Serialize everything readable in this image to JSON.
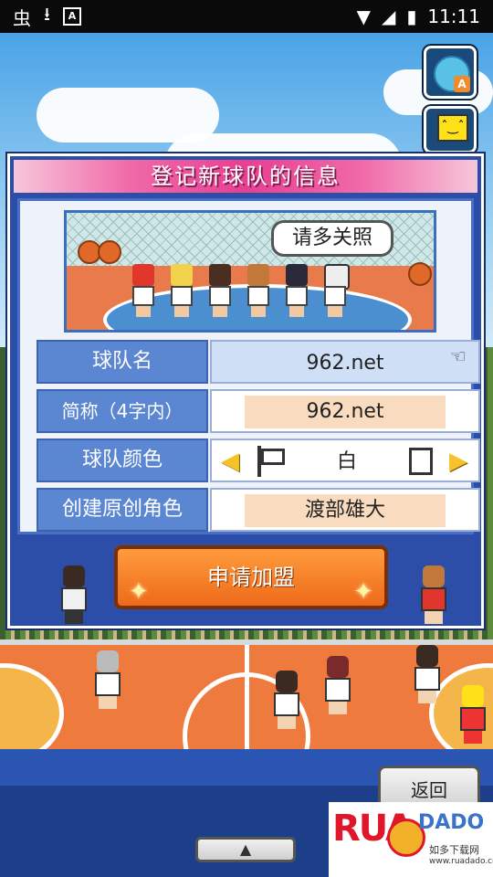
{
  "status_bar": {
    "left_icons": [
      "bug-icon",
      "download-icon",
      "a-icon"
    ],
    "time": "11:11",
    "right_icons": [
      "wifi-icon",
      "signal-icon",
      "battery-icon"
    ]
  },
  "dialog": {
    "title": "登记新球队的信息",
    "banner_speech": "请多关照",
    "fields": [
      {
        "label": "球队名",
        "value": "962.net"
      },
      {
        "label": "简称（4字内）",
        "value": "962.net"
      },
      {
        "label": "球队颜色",
        "value": "白"
      },
      {
        "label": "创建原创角色",
        "value": "渡部雄大"
      }
    ],
    "join_button": "申请加盟"
  },
  "back_button": "返回",
  "watermark": {
    "brand": "RUADADO",
    "sub": "如多下载网",
    "url": "www.ruadado.com"
  },
  "colors": {
    "title_pink": "#e83f92",
    "dialog_blue": "#2c4ea8",
    "label_blue": "#5b86d2",
    "join_orange": "#ee6a1a",
    "court_orange": "#ef7a3d"
  }
}
